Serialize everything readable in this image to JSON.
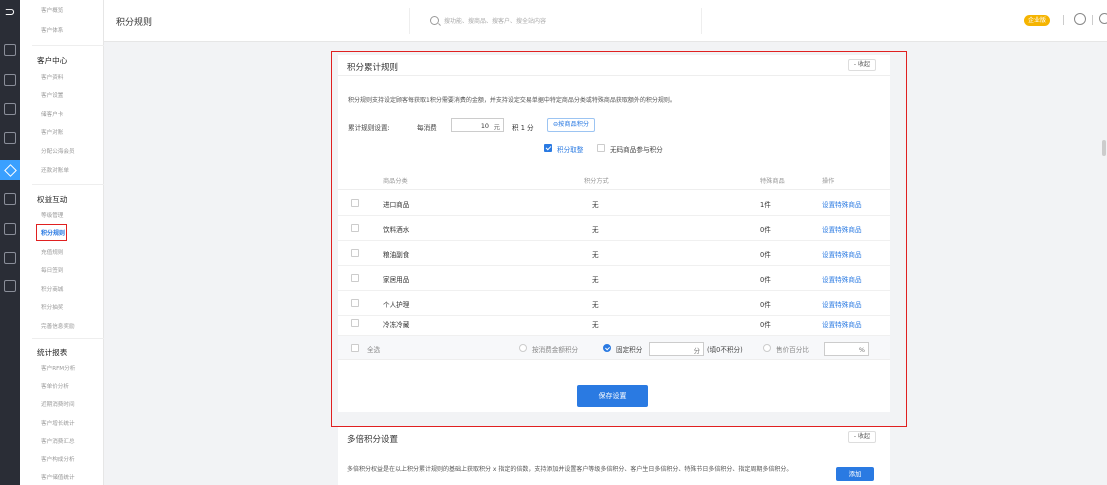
{
  "header": {
    "title": "积分规则",
    "search_placeholder": "搜功能、搜商品、搜客户、搜全站内容",
    "edition_badge": "企业版"
  },
  "sidebar": {
    "top_items": [
      "客户概览",
      "客户体系"
    ],
    "groups": [
      {
        "title": "客户中心",
        "items": [
          "客户资料",
          "客户设置",
          "储客户卡",
          "客户对账",
          "分配公海会员",
          "还款对账单"
        ]
      },
      {
        "title": "权益互动",
        "items": [
          "等级管理",
          "积分规则",
          "充值规则",
          "每日签到",
          "积分商城",
          "积分抽奖",
          "完善信息奖励"
        ]
      },
      {
        "title": "统计报表",
        "items": [
          "客户RFM分析",
          "客单价分析",
          "近期消费时间",
          "客户增长统计",
          "客户消费汇总",
          "客户构成分析",
          "客户储值统计"
        ]
      }
    ],
    "active": "积分规则"
  },
  "rule_panel": {
    "title": "积分累计规则",
    "collapse_label": "- 收起",
    "description": "积分规则支持设定顾客每获取1积分需要消费的金额，并支持设定交易单据中特定商品分类或特殊商品获取额外的积分规则。",
    "config_label": "累计规则设置:",
    "per_spend_label": "每消费",
    "amount_value": "10",
    "amount_unit": "元",
    "points_per_label": "积 1 分",
    "by_category_button": "⊖按商品积分",
    "round_label": "积分取整",
    "round_checked": true,
    "no_barcode_label": "无码商品参与积分",
    "no_barcode_checked": false,
    "table_headers": [
      "商品分类",
      "积分方式",
      "特殊商品",
      "操作"
    ],
    "rows": [
      {
        "category": "进口商品",
        "method": "无",
        "special": "1件",
        "action": "设置特殊商品"
      },
      {
        "category": "饮料酒水",
        "method": "无",
        "special": "0件",
        "action": "设置特殊商品"
      },
      {
        "category": "粮油副食",
        "method": "无",
        "special": "0件",
        "action": "设置特殊商品"
      },
      {
        "category": "家居用品",
        "method": "无",
        "special": "0件",
        "action": "设置特殊商品"
      },
      {
        "category": "个人护理",
        "method": "无",
        "special": "0件",
        "action": "设置特殊商品"
      },
      {
        "category": "冷冻冷藏",
        "method": "无",
        "special": "0件",
        "action": "设置特殊商品"
      }
    ],
    "footer": {
      "select_all": "全选",
      "opt_amount": "按消费金额积分",
      "opt_fixed": "固定积分",
      "fixed_unit": "分",
      "fixed_hint": "(填0不积分)",
      "opt_percent": "售价百分比",
      "percent_unit": "%",
      "selected": "固定积分"
    },
    "save_label": "保存设置"
  },
  "multi_panel": {
    "title": "多倍积分设置",
    "collapse_label": "- 收起",
    "description": "多倍积分权益是在以上积分累计规则的基础上获取积分 x 指定的倍数，支持添加并设置客户等级多倍积分、客户生日多倍积分、特殊节日多倍积分、指定周期多倍积分。",
    "add_label": "添加"
  },
  "colors": {
    "accent": "#2a7ae2",
    "highlight": "#e02020",
    "rail": "#2a2d36",
    "badge": "#f5b400"
  }
}
